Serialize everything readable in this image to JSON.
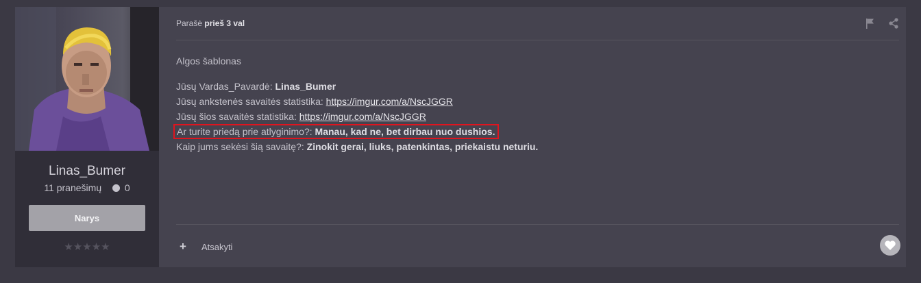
{
  "author": {
    "name": "Linas_Bumer",
    "posts_label": "11 pranešimų",
    "reputation": "0",
    "rank_label": "Narys",
    "stars": "★★★★★"
  },
  "post": {
    "meta_prefix": "Parašė",
    "meta_time": "prieš 3 val",
    "intro": "Algos šablonas",
    "lines": [
      {
        "label": "Jūsų Vardas_Pavardė:",
        "value": "Linas_Bumer"
      },
      {
        "label": "Jūsų ankstenės savaitės statistika:",
        "link": "https://imgur.com/a/NscJGGR"
      },
      {
        "label": "Jūsų šios savaitės  statistika:",
        "link": "https://imgur.com/a/NscJGGR"
      },
      {
        "label": "Ar turite priedą prie atlyginimo?:",
        "value": "Manau, kad ne, bet dirbau nuo dushios."
      },
      {
        "label": "Kaip jums sekėsi šią savaitę?:",
        "value": "Zinokit gerai, liuks, patenkintas, priekaistu neturiu."
      }
    ],
    "reply_label": "Atsakyti"
  },
  "icons": {
    "report": "flag-icon",
    "share": "share-icon",
    "reply": "plus-icon",
    "like": "heart-icon"
  },
  "colors": {
    "page_bg": "#3b3944",
    "content_bg": "#45434f",
    "author_bg": "#302e38",
    "highlight_border": "#e0141e"
  }
}
